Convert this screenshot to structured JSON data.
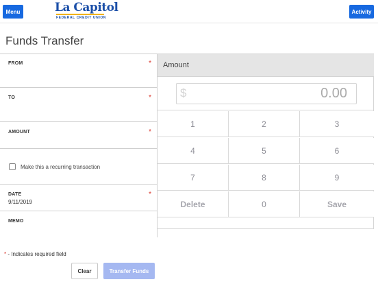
{
  "header": {
    "menu_label": "Menu",
    "activity_label": "Activity",
    "logo_name": "La Capitol",
    "logo_subtitle": "FEDERAL CREDIT UNION",
    "brand_color": "#1769e0"
  },
  "page": {
    "title": "Funds Transfer"
  },
  "form": {
    "from_label": "FROM",
    "to_label": "TO",
    "amount_label": "AMOUNT",
    "recurring_label": "Make this a recurring transaction",
    "recurring_checked": false,
    "date_label": "DATE",
    "date_value": "9/11/2019",
    "memo_label": "MEMO",
    "required_marker": "*"
  },
  "keypad": {
    "title": "Amount",
    "currency_symbol": "$",
    "display_value": "0.00",
    "keys": [
      "1",
      "2",
      "3",
      "4",
      "5",
      "6",
      "7",
      "8",
      "9",
      "Delete",
      "0",
      "Save"
    ]
  },
  "footer": {
    "required_star": "*",
    "required_note": " - Indicates required field",
    "clear_label": "Clear",
    "transfer_label": "Transfer Funds",
    "transfer_color": "#a5b8f1"
  }
}
